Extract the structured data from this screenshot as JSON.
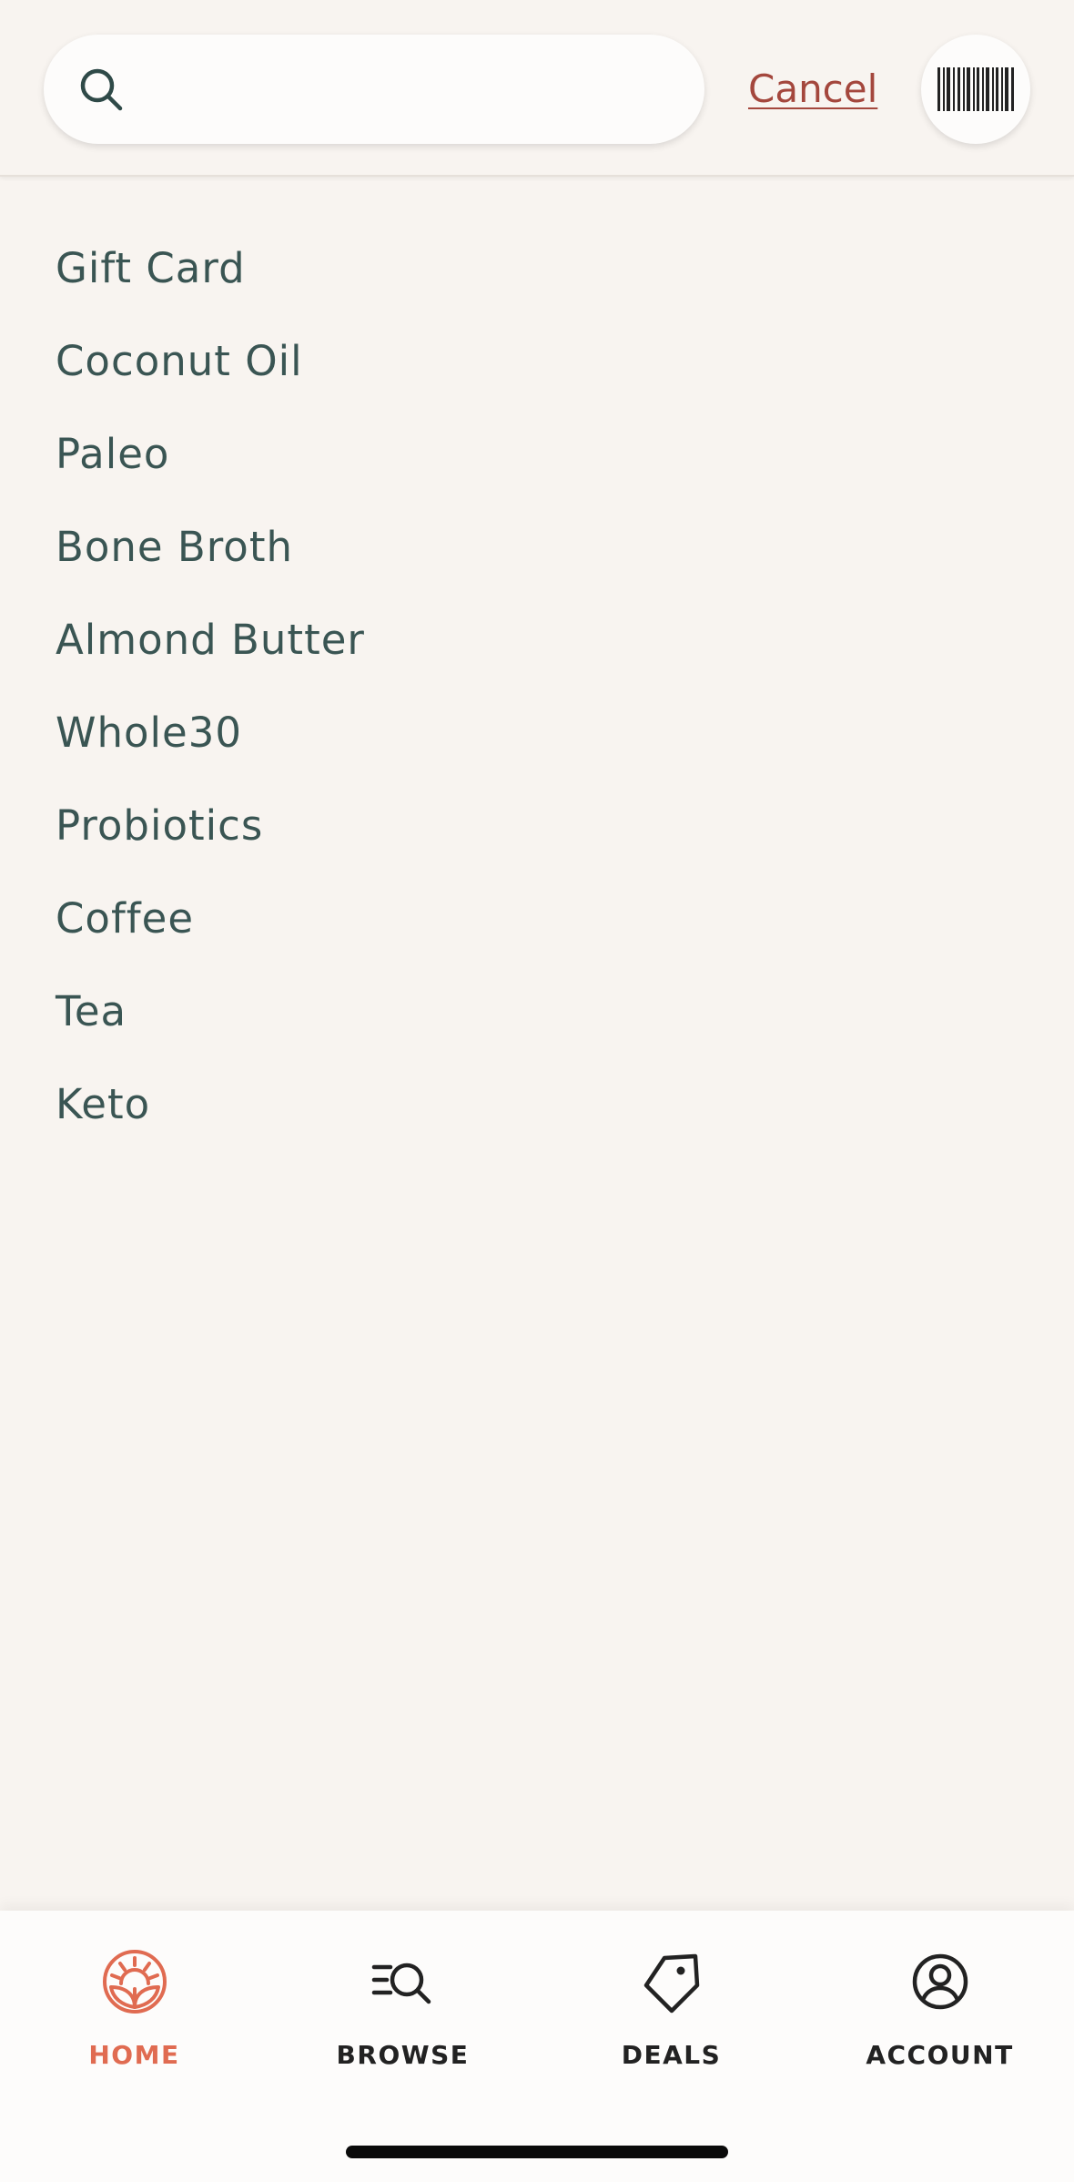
{
  "search": {
    "placeholder": "",
    "value": "",
    "cancel_label": "Cancel"
  },
  "suggestions": [
    "Gift Card",
    "Coconut Oil",
    "Paleo",
    "Bone Broth",
    "Almond Butter",
    "Whole30",
    "Probiotics",
    "Coffee",
    "Tea",
    "Keto"
  ],
  "tab_bar": {
    "items": [
      {
        "label": "HOME",
        "icon": "home-logo-icon",
        "active": true
      },
      {
        "label": "BROWSE",
        "icon": "browse-search-icon",
        "active": false
      },
      {
        "label": "DEALS",
        "icon": "tag-icon",
        "active": false
      },
      {
        "label": "ACCOUNT",
        "icon": "account-icon",
        "active": false
      }
    ]
  },
  "colors": {
    "background": "#f8f4f0",
    "text": "#3a5553",
    "accent": "#e06b51",
    "cancel": "#a4473d"
  }
}
